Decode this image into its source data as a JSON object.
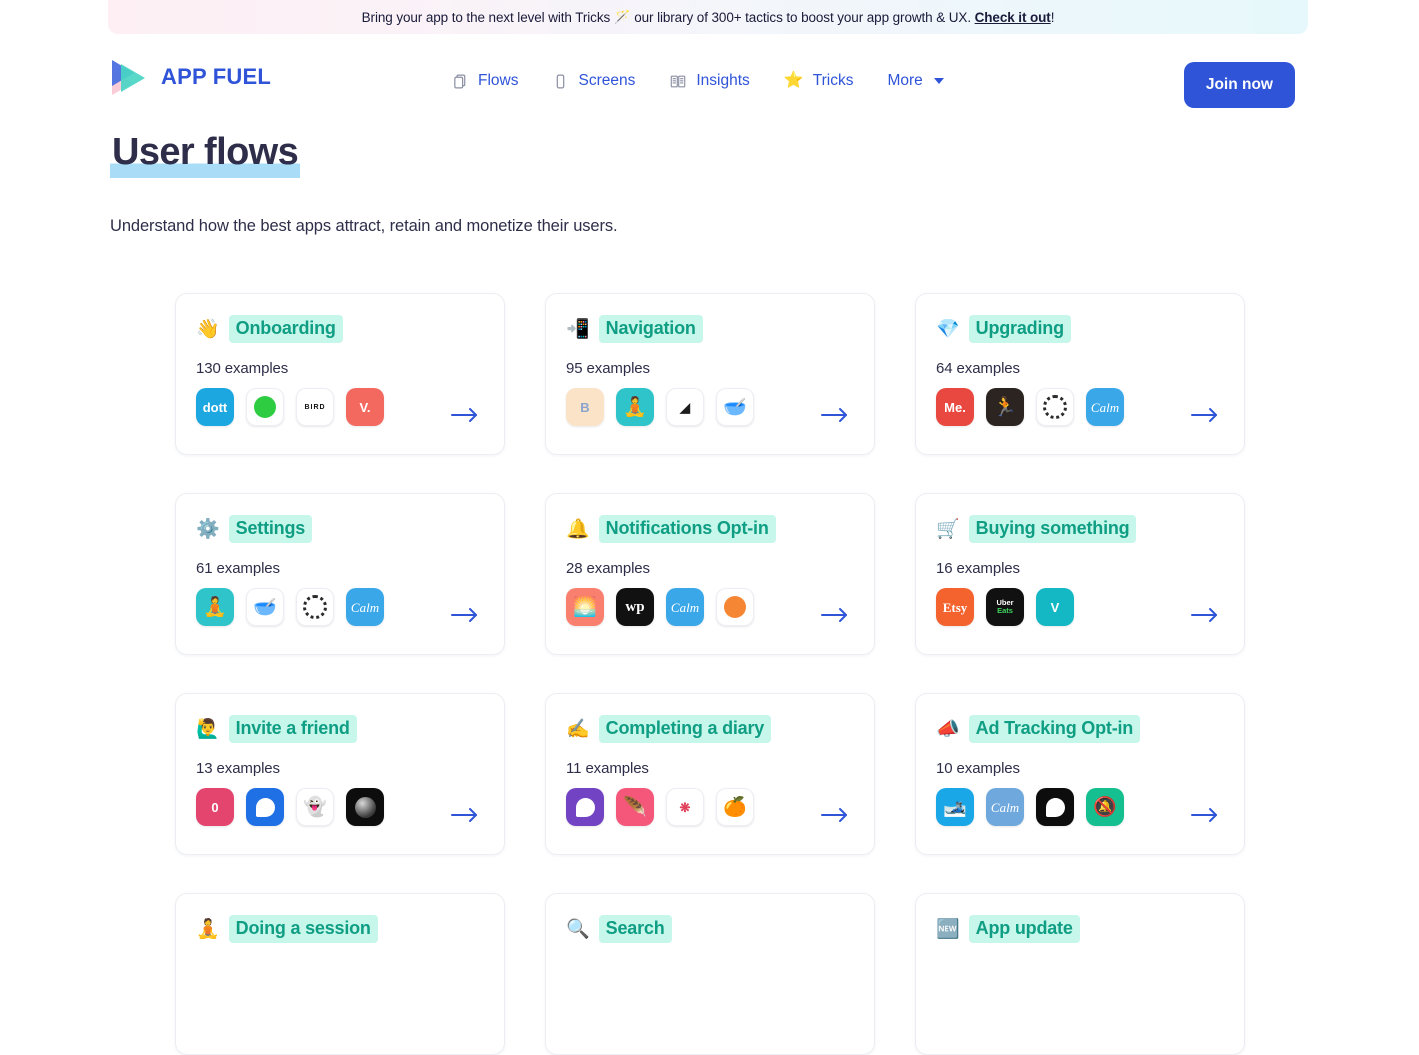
{
  "banner": {
    "text_before": "Bring your app to the next level with Tricks",
    "emoji": "🪄",
    "text_after": "our library of 300+ tactics to boost your app growth & UX.",
    "link_label": "Check it out",
    "link_suffix": "!",
    "gradient_from": "#fdeff4",
    "gradient_to": "#e6f8fb"
  },
  "header": {
    "logo_text": "APP FUEL",
    "brand_color": "#2f54d8",
    "nav": [
      {
        "label": "Flows",
        "icon": "stacked-cards-icon"
      },
      {
        "label": "Screens",
        "icon": "phone-icon"
      },
      {
        "label": "Insights",
        "icon": "book-icon"
      },
      {
        "label": "Tricks",
        "icon": "star-icon"
      },
      {
        "label": "More",
        "icon": "chevron-down-icon"
      }
    ],
    "cta_label": "Join now"
  },
  "page": {
    "title": "User flows",
    "title_highlight_color": "#a8dcf7",
    "subtitle": "Understand how the best apps attract, retain and monetize their users."
  },
  "cards": [
    {
      "emoji": "👋",
      "title": "Onboarding",
      "count": "130 examples",
      "apps": [
        {
          "name": "dott",
          "label": "dott",
          "bg": "#1da7e0",
          "text": "#ffffff",
          "style": "text"
        },
        {
          "name": "lime",
          "label": "",
          "bg": "#ffffff",
          "text": "#2ecc40",
          "style": "lime"
        },
        {
          "name": "bird",
          "label": "BIRD",
          "bg": "#ffffff",
          "text": "#111111",
          "style": "bird"
        },
        {
          "name": "vinted",
          "label": "V.",
          "bg": "#f4695f",
          "text": "#ffffff",
          "style": "text"
        }
      ]
    },
    {
      "emoji": "📲",
      "title": "Navigation",
      "count": "95 examples",
      "apps": [
        {
          "name": "blinkist",
          "label": "B",
          "bg": "#fbe3c8",
          "text": "#8aa4cf",
          "style": "text"
        },
        {
          "name": "meditation-app",
          "label": "🧘",
          "bg": "#2ec4ca",
          "text": "#ffffff",
          "style": "emoji"
        },
        {
          "name": "artifact",
          "label": "◢",
          "bg": "#ffffff",
          "text": "#1d1d1d",
          "style": "text"
        },
        {
          "name": "bowl-app",
          "label": "🥣",
          "bg": "#ffffff",
          "text": "#000000",
          "style": "emoji"
        }
      ]
    },
    {
      "emoji": "💎",
      "title": "Upgrading",
      "count": "64 examples",
      "apps": [
        {
          "name": "me-plus",
          "label": "Me.",
          "bg": "#e8483f",
          "text": "#ffffff",
          "style": "text"
        },
        {
          "name": "strava-dark",
          "label": "🏃",
          "bg": "#2b2420",
          "text": "#f56b3c",
          "style": "emoji"
        },
        {
          "name": "oura",
          "label": "",
          "bg": "#ffffff",
          "text": "#222222",
          "style": "ring"
        },
        {
          "name": "calm",
          "label": "Calm",
          "bg": "#3aa8e8",
          "text": "#ffffff",
          "style": "calm"
        }
      ]
    },
    {
      "emoji": "⚙️",
      "title": "Settings",
      "count": "61 examples",
      "apps": [
        {
          "name": "meditation-app",
          "label": "🧘",
          "bg": "#2ec4ca",
          "text": "#ffffff",
          "style": "emoji"
        },
        {
          "name": "bowl-app",
          "label": "🥣",
          "bg": "#ffffff",
          "text": "#000000",
          "style": "emoji"
        },
        {
          "name": "oura",
          "label": "",
          "bg": "#ffffff",
          "text": "#222222",
          "style": "ring"
        },
        {
          "name": "calm",
          "label": "Calm",
          "bg": "#3aa8e8",
          "text": "#ffffff",
          "style": "calm"
        }
      ]
    },
    {
      "emoji": "🔔",
      "title": "Notifications Opt-in",
      "count": "28 examples",
      "apps": [
        {
          "name": "sunrise-app",
          "label": "🌅",
          "bg": "#f9806e",
          "text": "#ffffff",
          "style": "emoji"
        },
        {
          "name": "washington-post",
          "label": "𝖜𝖕",
          "bg": "#111111",
          "text": "#ffffff",
          "style": "wp"
        },
        {
          "name": "calm",
          "label": "Calm",
          "bg": "#3aa8e8",
          "text": "#ffffff",
          "style": "calm"
        },
        {
          "name": "orange-dot-app",
          "label": "",
          "bg": "#ffffff",
          "text": "#f58634",
          "style": "dot"
        }
      ]
    },
    {
      "emoji": "🛒",
      "title": "Buying something",
      "count": "16 examples",
      "apps": [
        {
          "name": "etsy",
          "label": "Etsy",
          "bg": "#f4622e",
          "text": "#ffffff",
          "style": "serif"
        },
        {
          "name": "uber-eats",
          "label": "Uber Eats",
          "bg": "#111111",
          "text": "#3fd45e",
          "style": "ubereats"
        },
        {
          "name": "vinted",
          "label": "V",
          "bg": "#14b8c4",
          "text": "#ffffff",
          "style": "text"
        }
      ]
    },
    {
      "emoji": "🙋‍♂️",
      "title": "Invite a friend",
      "count": "13 examples",
      "apps": [
        {
          "name": "zero-app",
          "label": "0",
          "bg": "#e3456e",
          "text": "#ffffff",
          "style": "text"
        },
        {
          "name": "messenger-app",
          "label": "",
          "bg": "#1f6fe5",
          "text": "#ffffff",
          "style": "blob"
        },
        {
          "name": "ghost-app",
          "label": "👻",
          "bg": "#ffffff",
          "text": "#5a5a7a",
          "style": "emoji"
        },
        {
          "name": "dark-orb-app",
          "label": "",
          "bg": "#0d0d0d",
          "text": "#bfbfbf",
          "style": "orb"
        }
      ]
    },
    {
      "emoji": "✍️",
      "title": "Completing a diary",
      "count": "11 examples",
      "apps": [
        {
          "name": "journal-app",
          "label": "",
          "bg": "#7243c2",
          "text": "#ffffff",
          "style": "blob"
        },
        {
          "name": "feather-app",
          "label": "🪶",
          "bg": "#f4577a",
          "text": "#ffffff",
          "style": "emoji"
        },
        {
          "name": "flower-app",
          "label": "❋",
          "bg": "#ffffff",
          "text": "#e2405a",
          "style": "text"
        },
        {
          "name": "orange-fruit-app",
          "label": "🍊",
          "bg": "#ffffff",
          "text": "#f58634",
          "style": "emoji"
        }
      ]
    },
    {
      "emoji": "📣",
      "title": "Ad Tracking Opt-in",
      "count": "10 examples",
      "apps": [
        {
          "name": "skis-app",
          "label": "🎿",
          "bg": "#19a7e8",
          "text": "#ffffff",
          "style": "emoji"
        },
        {
          "name": "calm",
          "label": "Calm",
          "bg": "#6fa8dc",
          "text": "#ffffff",
          "style": "calm"
        },
        {
          "name": "black-shape-app",
          "label": "",
          "bg": "#0d0d0d",
          "text": "#ffffff",
          "style": "blob"
        },
        {
          "name": "green-app",
          "label": "🔕",
          "bg": "#16bf8f",
          "text": "#ffffff",
          "style": "emoji"
        }
      ]
    },
    {
      "emoji": "🧘",
      "title": "Doing a session",
      "count": "",
      "apps": []
    },
    {
      "emoji": "🔍",
      "title": "Search",
      "count": "",
      "apps": []
    },
    {
      "emoji": "🆕",
      "title": "App update",
      "count": "",
      "apps": []
    }
  ]
}
